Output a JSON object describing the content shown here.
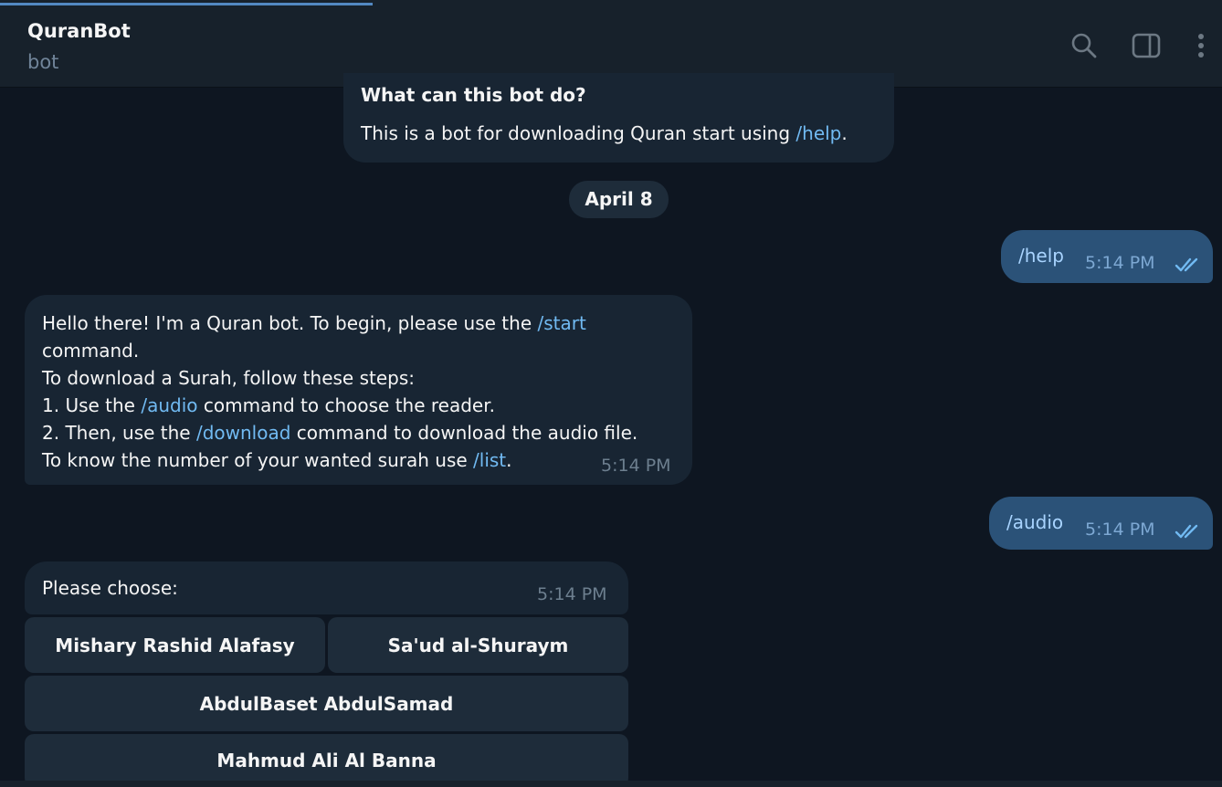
{
  "header": {
    "title": "QuranBot",
    "subtitle": "bot",
    "icons": [
      "search-icon",
      "sidebar-toggle-icon",
      "more-vertical-icon"
    ]
  },
  "info_card": {
    "title": "What can this bot do?",
    "text_before": "This is a bot for downloading Quran start using ",
    "link": "/help",
    "text_after": "."
  },
  "date_separator": "April 8",
  "messages": {
    "help_cmd": {
      "text": "/help",
      "time": "5:14 PM"
    },
    "intro": {
      "line1_before": "Hello there! I'm a Quran bot. To begin, please use the ",
      "line1_link": "/start",
      "line2": "command.",
      "line3": "To download a Surah, follow these steps:",
      "line4_before": "1. Use the ",
      "line4_link": "/audio",
      "line4_after": " command to choose the reader.",
      "line5_before": "2. Then, use the ",
      "line5_link": "/download",
      "line5_after": " command to download the audio file.",
      "line6_before": "To know the number of your wanted surah use ",
      "line6_link": "/list",
      "line6_after": ".",
      "time": "5:14 PM"
    },
    "audio_cmd": {
      "text": "/audio",
      "time": "5:14 PM"
    },
    "choose": {
      "text": "Please choose:",
      "time": "5:14 PM"
    }
  },
  "keyboard": {
    "buttons": [
      "Mishary Rashid Alafasy",
      "Sa'ud al-Shuraym",
      "AbdulBaset AbdulSamad",
      "Mahmud Ali Al Banna"
    ]
  },
  "colors": {
    "background": "#0e1621",
    "header": "#17212b",
    "incoming_bubble": "#182533",
    "outgoing_bubble": "#2b5278",
    "link": "#71baf2",
    "accent": "#5288c1"
  }
}
